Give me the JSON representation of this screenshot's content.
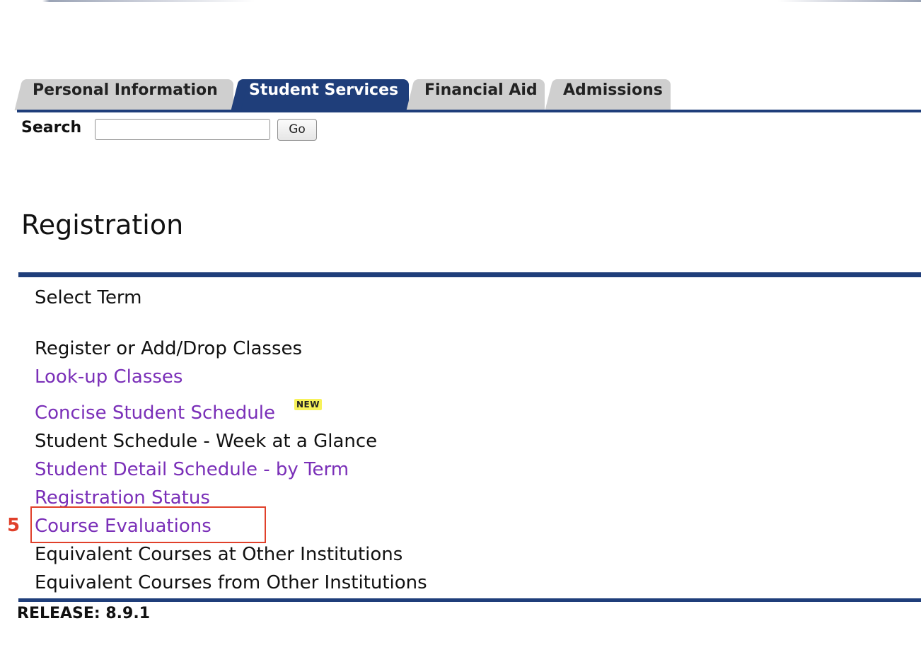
{
  "tabs": [
    {
      "label": "Personal Information",
      "active": false
    },
    {
      "label": "Student Services",
      "active": true
    },
    {
      "label": "Financial Aid",
      "active": false
    },
    {
      "label": "Admissions",
      "active": false
    }
  ],
  "search": {
    "label": "Search",
    "value": "",
    "button_label": "Go"
  },
  "page": {
    "title": "Registration"
  },
  "menu": {
    "items": [
      {
        "label": "Select Term",
        "is_link": false
      },
      {
        "label": "Register or Add/Drop Classes",
        "is_link": false
      },
      {
        "label": "Look-up Classes",
        "is_link": true
      },
      {
        "label": "Concise Student Schedule",
        "is_link": true,
        "badge": "NEW"
      },
      {
        "label": "Student Schedule - Week at a Glance",
        "is_link": false
      },
      {
        "label": "Student Detail Schedule - by Term",
        "is_link": true
      },
      {
        "label": "Registration Status",
        "is_link": true
      },
      {
        "label": "Course Evaluations",
        "is_link": true
      },
      {
        "label": "Equivalent Courses at Other Institutions",
        "is_link": false
      },
      {
        "label": "Equivalent Courses from Other Institutions",
        "is_link": false
      }
    ]
  },
  "annotation": {
    "step_number": "5",
    "color": "#e0402a"
  },
  "footer": {
    "release": "RELEASE: 8.9.1"
  },
  "colors": {
    "nav_blue": "#1f3e7a",
    "link_purple": "#7a2fb8",
    "tab_gray": "#cfcfcf"
  }
}
